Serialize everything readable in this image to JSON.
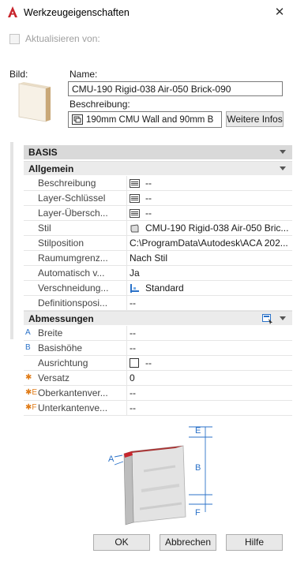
{
  "window": {
    "title": "Werkzeugeigenschaften",
    "close_icon": "close-icon"
  },
  "update": {
    "label": "Aktualisieren von:",
    "checked": false
  },
  "preview": {
    "label": "Bild:"
  },
  "name": {
    "label": "Name:",
    "value": "CMU-190 Rigid-038 Air-050 Brick-090"
  },
  "description": {
    "label": "Beschreibung:",
    "value": "190mm CMU Wall and 90mm B",
    "more_button": "Weitere Infos"
  },
  "grid": {
    "category": "BASIS",
    "groups": {
      "general": "Allgemein",
      "dimensions": "Abmessungen"
    },
    "general_rows": [
      {
        "name": "Beschreibung",
        "value": "--",
        "icon": "list-icon"
      },
      {
        "name": "Layer-Schlüssel",
        "value": "--",
        "icon": "list-icon"
      },
      {
        "name": "Layer-Übersch...",
        "value": "--",
        "icon": "list-icon"
      },
      {
        "name": "Stil",
        "value": "CMU-190 Rigid-038 Air-050 Bric...",
        "icon": "wall-style-icon"
      },
      {
        "name": "Stilposition",
        "value": "C:\\ProgramData\\Autodesk\\ACA  202..."
      },
      {
        "name": "Raumumgrenz...",
        "value": "Nach Stil"
      },
      {
        "name": "Automatisch v...",
        "value": "Ja"
      },
      {
        "name": "Verschneidung...",
        "value": "Standard",
        "icon": "cleanup-icon"
      },
      {
        "name": "Definitionsposi...",
        "value": "--"
      }
    ],
    "dimension_rows": [
      {
        "marker": "A",
        "name": "Breite",
        "value": "--"
      },
      {
        "marker": "B",
        "name": "Basishöhe",
        "value": "--"
      },
      {
        "marker": "",
        "name": "Ausrichtung",
        "value": "--",
        "checkbox": true
      },
      {
        "marker": "✱",
        "name": "Versatz",
        "value": "0"
      },
      {
        "marker": "✱E",
        "name": "Oberkantenver...",
        "value": "--"
      },
      {
        "marker": "✱F",
        "name": "Unterkantenve...",
        "value": "--"
      }
    ]
  },
  "diagram": {
    "labels": {
      "a": "A",
      "b": "B",
      "e": "E",
      "f": "F"
    }
  },
  "buttons": {
    "ok": "OK",
    "cancel": "Abbrechen",
    "help": "Hilfe"
  },
  "colors": {
    "accent_red": "#c8252c",
    "marker_blue": "#2b72c8",
    "marker_orange": "#e07b17",
    "category_bg": "#d9d9d9",
    "group_bg": "#ebebeb"
  }
}
